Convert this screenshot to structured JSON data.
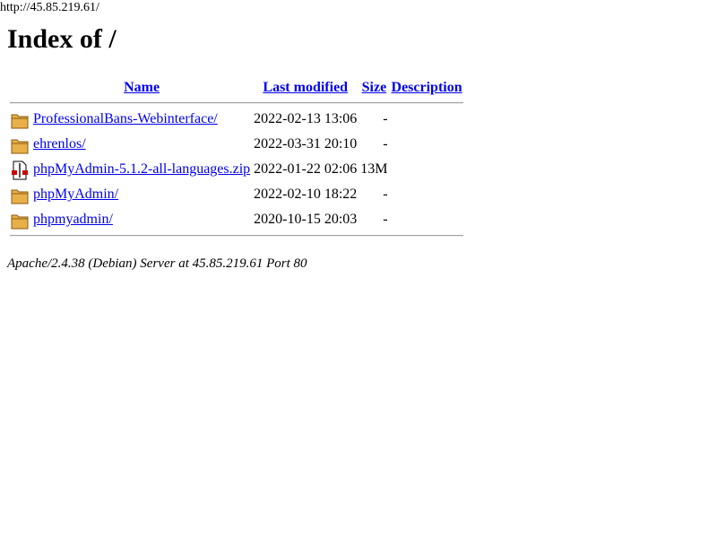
{
  "address_bar": {
    "url": "http://45.85.219.61/"
  },
  "page": {
    "title": "Index of /"
  },
  "table": {
    "headers": {
      "name": "Name",
      "last_modified": "Last modified",
      "size": "Size",
      "description": "Description"
    },
    "rows": [
      {
        "icon": "folder-icon",
        "name": "ProfessionalBans-Webinterface/",
        "modified": "2022-02-13 13:06",
        "size": "-",
        "description": ""
      },
      {
        "icon": "folder-icon",
        "name": "ehrenlos/",
        "modified": "2022-03-31 20:10",
        "size": "-",
        "description": ""
      },
      {
        "icon": "compressed-file-icon",
        "name": "phpMyAdmin-5.1.2-all-languages.zip",
        "modified": "2022-01-22 02:06",
        "size": "13M",
        "description": ""
      },
      {
        "icon": "folder-icon",
        "name": "phpMyAdmin/",
        "modified": "2022-02-10 18:22",
        "size": "-",
        "description": ""
      },
      {
        "icon": "folder-icon",
        "name": "phpmyadmin/",
        "modified": "2020-10-15 20:03",
        "size": "-",
        "description": ""
      }
    ]
  },
  "footer": {
    "server_signature": "Apache/2.4.38 (Debian) Server at 45.85.219.61 Port 80"
  },
  "colors": {
    "link": "#0000ee",
    "folder": "#e8b04a",
    "rule": "#a0a0a0"
  }
}
